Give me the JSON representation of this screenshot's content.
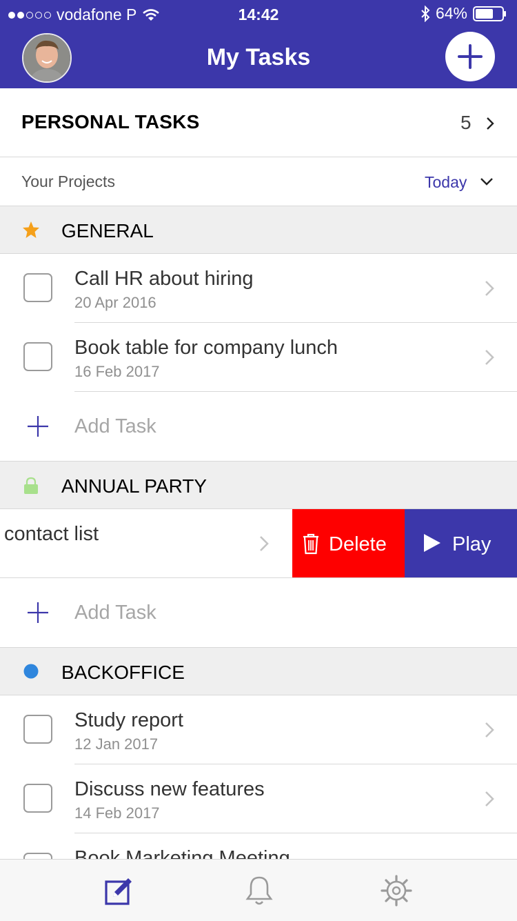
{
  "status_bar": {
    "carrier": "vodafone P",
    "time": "14:42",
    "battery": "64%",
    "battery_level": 0.64
  },
  "header": {
    "title": "My Tasks",
    "avatar_icon": "user-avatar",
    "add_icon": "plus-icon"
  },
  "personal": {
    "label": "PERSONAL TASKS",
    "count": "5"
  },
  "projects": {
    "label": "Your Projects",
    "filter": "Today"
  },
  "sections": [
    {
      "name": "GENERAL",
      "icon": "star-icon",
      "color": "#f5a01a",
      "tasks": [
        {
          "title": "Call HR about hiring",
          "date": "20 Apr 2016"
        },
        {
          "title": "Book table for company lunch",
          "date": "16 Feb 2017"
        }
      ],
      "add_label": "Add Task"
    },
    {
      "name": "ANNUAL PARTY",
      "icon": "lock-icon",
      "color": "#a8e08c",
      "tasks": [
        {
          "title": "contact list"
        }
      ],
      "add_label": "Add Task"
    },
    {
      "name": "BACKOFFICE",
      "icon": "circle-icon",
      "color": "#2f86dd",
      "tasks": [
        {
          "title": "Study report",
          "date": "12 Jan 2017"
        },
        {
          "title": "Discuss new features",
          "date": "14 Feb 2017"
        },
        {
          "title": "Book Marketing Meeting"
        }
      ]
    }
  ],
  "swipe_actions": {
    "delete_label": "Delete",
    "play_label": "Play",
    "delete_color": "#fe0000",
    "play_color": "#3c37aa"
  },
  "tabbar": {
    "tabs": [
      {
        "icon": "edit-icon",
        "active": true
      },
      {
        "icon": "bell-icon",
        "active": false
      },
      {
        "icon": "gear-icon",
        "active": false
      }
    ]
  },
  "colors": {
    "brand": "#3c37aa",
    "background": "#ffffff",
    "section_background": "#efefef"
  }
}
